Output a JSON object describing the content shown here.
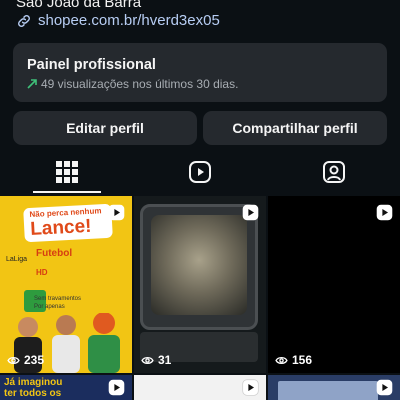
{
  "profile": {
    "location": "São João da Barra",
    "link": "shopee.com.br/hverd3ex05",
    "link_icon": "link-icon"
  },
  "panel": {
    "title": "Painel profissional",
    "subtitle": "49 visualizações nos últimos 30 dias.",
    "trend_icon": "trend-up-arrow-icon"
  },
  "buttons": {
    "edit": "Editar perfil",
    "share": "Compartilhar perfil"
  },
  "tabs": [
    {
      "icon": "grid-icon",
      "active": true
    },
    {
      "icon": "reels-icon",
      "active": false
    },
    {
      "icon": "tagged-person-icon",
      "active": false
    }
  ],
  "posts": [
    {
      "views": "235",
      "ad": {
        "top_text": "Não perca nenhum",
        "big_text": "Lance!",
        "league": "LaLiga",
        "futebol": "Futebol",
        "hd": "HD",
        "line1": "Sem travamentos",
        "line2": "Por apenas"
      }
    },
    {
      "views": "31"
    },
    {
      "views": "156"
    },
    {
      "partial_text": "Já imaginou\nter todos os"
    },
    {},
    {}
  ],
  "colors": {
    "background": "#0b1014",
    "card": "#25292e",
    "link": "#b7cdf3",
    "trend": "#3fc07a"
  }
}
